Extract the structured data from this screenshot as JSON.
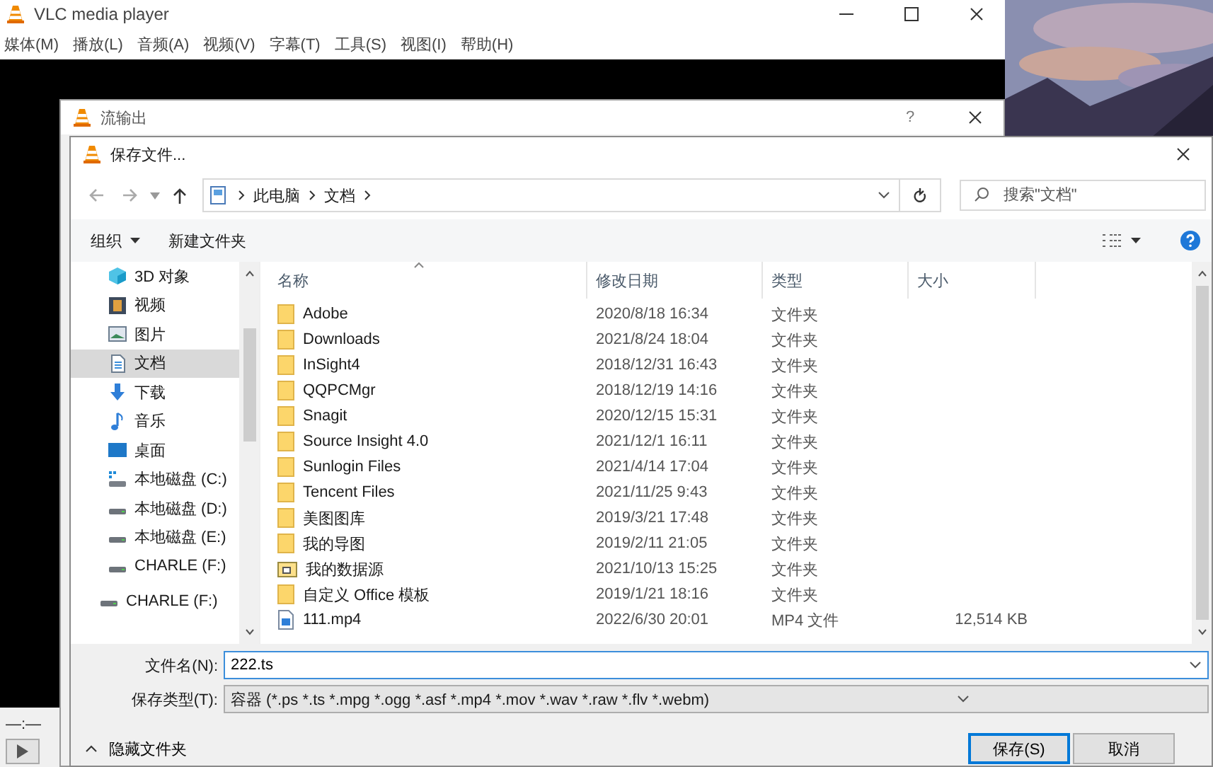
{
  "vlc": {
    "title": "VLC media player",
    "menu": [
      "媒体(M)",
      "播放(L)",
      "音频(A)",
      "视频(V)",
      "字幕(T)",
      "工具(S)",
      "视图(I)",
      "帮助(H)"
    ],
    "time": "—:—"
  },
  "stream_dialog": {
    "title": "流输出",
    "help": "?"
  },
  "save_dialog": {
    "title": "保存文件...",
    "breadcrumb": [
      "此电脑",
      "文档"
    ],
    "search": {
      "placeholder": "搜索\"文档\""
    },
    "toolbar": {
      "organize": "组织",
      "new_folder": "新建文件夹"
    },
    "sidebar": {
      "pc_items": [
        {
          "label": "3D 对象",
          "kind": "objects",
          "selected": false
        },
        {
          "label": "视频",
          "kind": "videos",
          "selected": false
        },
        {
          "label": "图片",
          "kind": "pictures",
          "selected": false
        },
        {
          "label": "文档",
          "kind": "documents",
          "selected": true
        },
        {
          "label": "下载",
          "kind": "downloads",
          "selected": false
        },
        {
          "label": "音乐",
          "kind": "music",
          "selected": false
        },
        {
          "label": "桌面",
          "kind": "desktop",
          "selected": false
        },
        {
          "label": "本地磁盘 (C:)",
          "kind": "system",
          "selected": false
        },
        {
          "label": "本地磁盘 (D:)",
          "kind": "drive",
          "selected": false
        },
        {
          "label": "本地磁盘 (E:)",
          "kind": "drive",
          "selected": false
        },
        {
          "label": "CHARLE (F:)",
          "kind": "drive",
          "selected": false
        }
      ],
      "root_items": [
        {
          "label": "CHARLE (F:)",
          "kind": "drive",
          "selected": false
        }
      ]
    },
    "columns": [
      "名称",
      "修改日期",
      "类型",
      "大小"
    ],
    "rows": [
      {
        "name": "Adobe",
        "modified": "2020/8/18 16:34",
        "type": "文件夹",
        "kind": "folder"
      },
      {
        "name": "Downloads",
        "modified": "2021/8/24 18:04",
        "type": "文件夹",
        "kind": "folder"
      },
      {
        "name": "InSight4",
        "modified": "2018/12/31 16:43",
        "type": "文件夹",
        "kind": "folder"
      },
      {
        "name": "QQPCMgr",
        "modified": "2018/12/19 14:16",
        "type": "文件夹",
        "kind": "folder"
      },
      {
        "name": "Snagit",
        "modified": "2020/12/15 15:31",
        "type": "文件夹",
        "kind": "folder"
      },
      {
        "name": "Source Insight 4.0",
        "modified": "2021/12/1 16:11",
        "type": "文件夹",
        "kind": "folder"
      },
      {
        "name": "Sunlogin Files",
        "modified": "2021/4/14 17:04",
        "type": "文件夹",
        "kind": "folder"
      },
      {
        "name": "Tencent Files",
        "modified": "2021/11/25 9:43",
        "type": "文件夹",
        "kind": "folder"
      },
      {
        "name": "美图图库",
        "modified": "2019/3/21 17:48",
        "type": "文件夹",
        "kind": "folder"
      },
      {
        "name": "我的导图",
        "modified": "2019/2/11 21:05",
        "type": "文件夹",
        "kind": "folder"
      },
      {
        "name": "我的数据源",
        "modified": "2021/10/13 15:25",
        "type": "文件夹",
        "kind": "data-folder"
      },
      {
        "name": "自定义 Office 模板",
        "modified": "2019/1/21 18:16",
        "type": "文件夹",
        "kind": "folder"
      },
      {
        "name": "111.mp4",
        "modified": "2022/6/30 20:01",
        "type": "MP4 文件",
        "size": "12,514 KB",
        "kind": "video"
      }
    ],
    "file_name": {
      "label": "文件名(N):",
      "value": "222.ts"
    },
    "file_type": {
      "label": "保存类型(T):",
      "value": "容器 (*.ps *.ts *.mpg *.ogg *.asf *.mp4 *.mov *.wav *.raw *.flv *.webm)"
    },
    "hide_folders": "隐藏文件夹",
    "buttons": [
      {
        "label": "保存(S)",
        "kind": "default"
      },
      {
        "label": "取消",
        "kind": "normal"
      }
    ]
  }
}
